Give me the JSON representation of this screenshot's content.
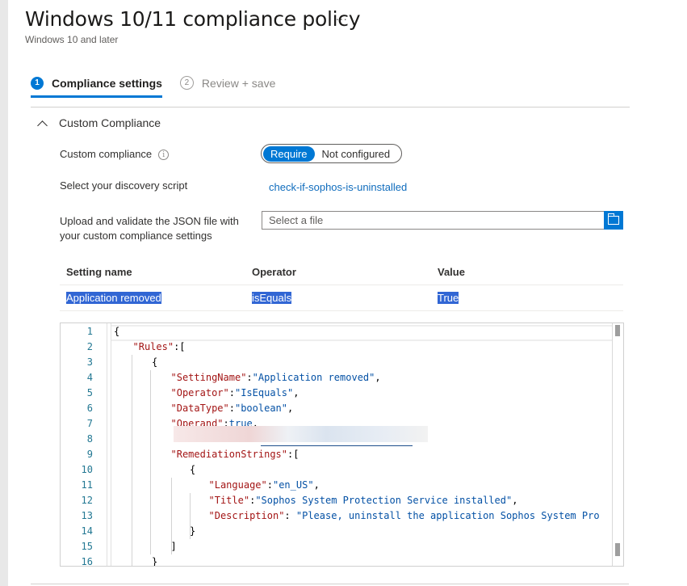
{
  "header": {
    "title": "Windows 10/11 compliance policy",
    "subtitle": "Windows 10 and later",
    "more_label": "..."
  },
  "wizard": {
    "steps": [
      {
        "number": "1",
        "label": "Compliance settings",
        "state": "active"
      },
      {
        "number": "2",
        "label": "Review + save",
        "state": "inactive"
      }
    ]
  },
  "section": {
    "title": "Custom Compliance",
    "expanded": true
  },
  "fields": {
    "custom_compliance": {
      "label": "Custom compliance",
      "info_icon": "info-icon",
      "options": [
        "Require",
        "Not configured"
      ],
      "selected": "Require"
    },
    "discovery_script": {
      "label": "Select your discovery script",
      "value": "check-if-sophos-is-uninstalled"
    },
    "json_upload": {
      "label_line1": "Upload and validate the JSON file with",
      "label_line2": "your custom compliance settings",
      "placeholder": "Select a file",
      "browse_icon": "folder-icon"
    }
  },
  "table": {
    "headers": [
      "Setting name",
      "Operator",
      "Value"
    ],
    "rows": [
      [
        "Application removed",
        "isEquals",
        "True"
      ]
    ]
  },
  "editor": {
    "lines": [
      {
        "n": "1",
        "indent": 0,
        "tokens": [
          [
            "p",
            "{"
          ]
        ]
      },
      {
        "n": "2",
        "indent": 1,
        "tokens": [
          [
            "k",
            "\"Rules\""
          ],
          [
            "p",
            ":["
          ]
        ]
      },
      {
        "n": "3",
        "indent": 2,
        "tokens": [
          [
            "p",
            "{"
          ]
        ]
      },
      {
        "n": "4",
        "indent": 3,
        "tokens": [
          [
            "k",
            "\"SettingName\""
          ],
          [
            "p",
            ":"
          ],
          [
            "s",
            "\"Application removed\""
          ],
          [
            "p",
            ","
          ]
        ]
      },
      {
        "n": "5",
        "indent": 3,
        "tokens": [
          [
            "k",
            "\"Operator\""
          ],
          [
            "p",
            ":"
          ],
          [
            "s",
            "\"IsEquals\""
          ],
          [
            "p",
            ","
          ]
        ]
      },
      {
        "n": "6",
        "indent": 3,
        "tokens": [
          [
            "k",
            "\"DataType\""
          ],
          [
            "p",
            ":"
          ],
          [
            "s",
            "\"boolean\""
          ],
          [
            "p",
            ","
          ]
        ]
      },
      {
        "n": "7",
        "indent": 3,
        "tokens": [
          [
            "k",
            "\"Operand\""
          ],
          [
            "p",
            ":"
          ],
          [
            "b",
            "true"
          ],
          [
            "p",
            ","
          ]
        ]
      },
      {
        "n": "8",
        "indent": 3,
        "tokens": []
      },
      {
        "n": "9",
        "indent": 3,
        "tokens": [
          [
            "k",
            "\"RemediationStrings\""
          ],
          [
            "p",
            ":["
          ]
        ]
      },
      {
        "n": "10",
        "indent": 4,
        "tokens": [
          [
            "p",
            "{"
          ]
        ]
      },
      {
        "n": "11",
        "indent": 5,
        "tokens": [
          [
            "k",
            "\"Language\""
          ],
          [
            "p",
            ":"
          ],
          [
            "s",
            "\"en_US\""
          ],
          [
            "p",
            ","
          ]
        ]
      },
      {
        "n": "12",
        "indent": 5,
        "tokens": [
          [
            "k",
            "\"Title\""
          ],
          [
            "p",
            ":"
          ],
          [
            "s",
            "\"Sophos System Protection Service installed\""
          ],
          [
            "p",
            ","
          ]
        ]
      },
      {
        "n": "13",
        "indent": 5,
        "tokens": [
          [
            "k",
            "\"Description\""
          ],
          [
            "p",
            ": "
          ],
          [
            "s",
            "\"Please, uninstall the application Sophos System Pro"
          ]
        ]
      },
      {
        "n": "14",
        "indent": 4,
        "tokens": [
          [
            "p",
            "}"
          ]
        ]
      },
      {
        "n": "15",
        "indent": 3,
        "tokens": [
          [
            "p",
            "]"
          ]
        ]
      },
      {
        "n": "16",
        "indent": 2,
        "tokens": [
          [
            "p",
            "}"
          ]
        ]
      }
    ],
    "redacted_line": "8"
  }
}
